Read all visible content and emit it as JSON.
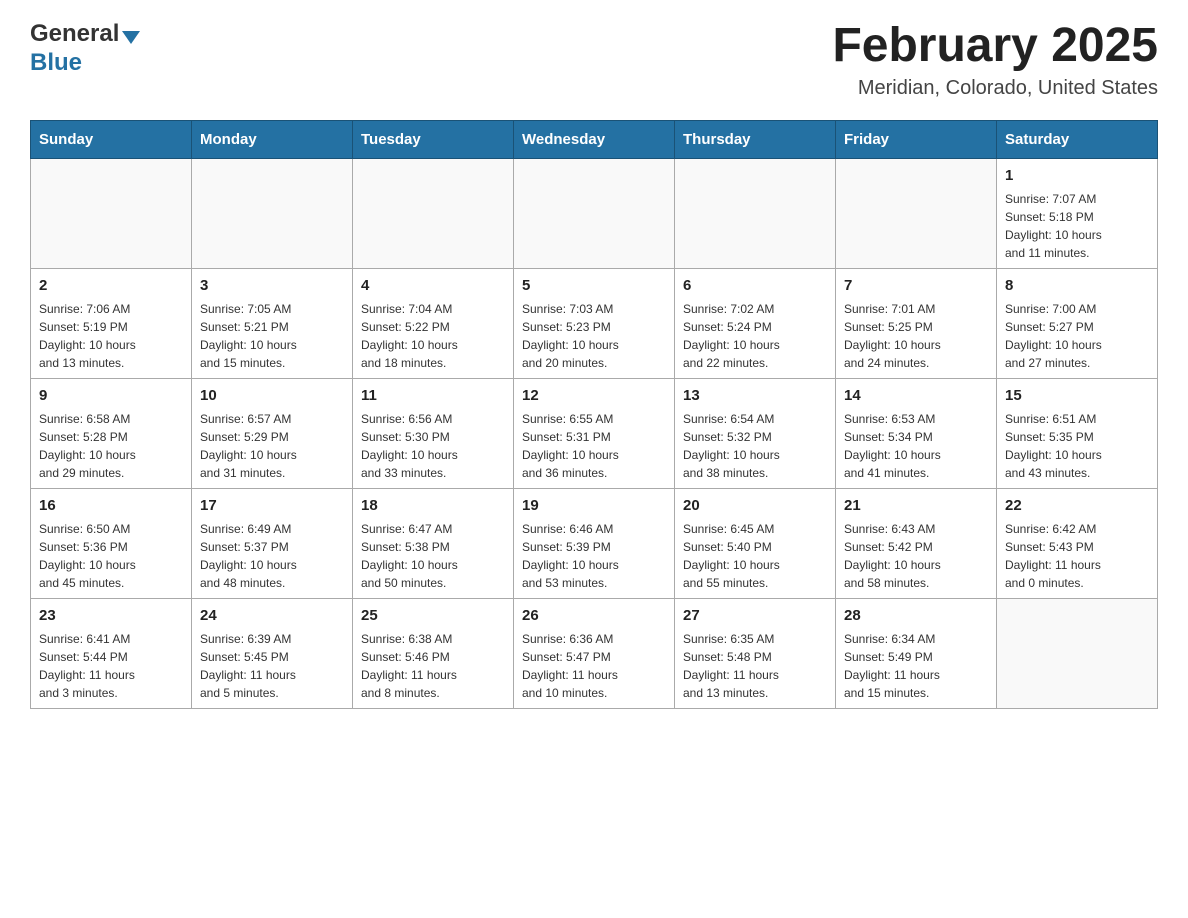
{
  "header": {
    "title": "February 2025",
    "subtitle": "Meridian, Colorado, United States",
    "logo_general": "General",
    "logo_blue": "Blue"
  },
  "days_of_week": [
    "Sunday",
    "Monday",
    "Tuesday",
    "Wednesday",
    "Thursday",
    "Friday",
    "Saturday"
  ],
  "weeks": [
    [
      {
        "day": "",
        "info": "",
        "empty": true
      },
      {
        "day": "",
        "info": "",
        "empty": true
      },
      {
        "day": "",
        "info": "",
        "empty": true
      },
      {
        "day": "",
        "info": "",
        "empty": true
      },
      {
        "day": "",
        "info": "",
        "empty": true
      },
      {
        "day": "",
        "info": "",
        "empty": true
      },
      {
        "day": "1",
        "info": "Sunrise: 7:07 AM\nSunset: 5:18 PM\nDaylight: 10 hours\nand 11 minutes.",
        "empty": false
      }
    ],
    [
      {
        "day": "2",
        "info": "Sunrise: 7:06 AM\nSunset: 5:19 PM\nDaylight: 10 hours\nand 13 minutes.",
        "empty": false
      },
      {
        "day": "3",
        "info": "Sunrise: 7:05 AM\nSunset: 5:21 PM\nDaylight: 10 hours\nand 15 minutes.",
        "empty": false
      },
      {
        "day": "4",
        "info": "Sunrise: 7:04 AM\nSunset: 5:22 PM\nDaylight: 10 hours\nand 18 minutes.",
        "empty": false
      },
      {
        "day": "5",
        "info": "Sunrise: 7:03 AM\nSunset: 5:23 PM\nDaylight: 10 hours\nand 20 minutes.",
        "empty": false
      },
      {
        "day": "6",
        "info": "Sunrise: 7:02 AM\nSunset: 5:24 PM\nDaylight: 10 hours\nand 22 minutes.",
        "empty": false
      },
      {
        "day": "7",
        "info": "Sunrise: 7:01 AM\nSunset: 5:25 PM\nDaylight: 10 hours\nand 24 minutes.",
        "empty": false
      },
      {
        "day": "8",
        "info": "Sunrise: 7:00 AM\nSunset: 5:27 PM\nDaylight: 10 hours\nand 27 minutes.",
        "empty": false
      }
    ],
    [
      {
        "day": "9",
        "info": "Sunrise: 6:58 AM\nSunset: 5:28 PM\nDaylight: 10 hours\nand 29 minutes.",
        "empty": false
      },
      {
        "day": "10",
        "info": "Sunrise: 6:57 AM\nSunset: 5:29 PM\nDaylight: 10 hours\nand 31 minutes.",
        "empty": false
      },
      {
        "day": "11",
        "info": "Sunrise: 6:56 AM\nSunset: 5:30 PM\nDaylight: 10 hours\nand 33 minutes.",
        "empty": false
      },
      {
        "day": "12",
        "info": "Sunrise: 6:55 AM\nSunset: 5:31 PM\nDaylight: 10 hours\nand 36 minutes.",
        "empty": false
      },
      {
        "day": "13",
        "info": "Sunrise: 6:54 AM\nSunset: 5:32 PM\nDaylight: 10 hours\nand 38 minutes.",
        "empty": false
      },
      {
        "day": "14",
        "info": "Sunrise: 6:53 AM\nSunset: 5:34 PM\nDaylight: 10 hours\nand 41 minutes.",
        "empty": false
      },
      {
        "day": "15",
        "info": "Sunrise: 6:51 AM\nSunset: 5:35 PM\nDaylight: 10 hours\nand 43 minutes.",
        "empty": false
      }
    ],
    [
      {
        "day": "16",
        "info": "Sunrise: 6:50 AM\nSunset: 5:36 PM\nDaylight: 10 hours\nand 45 minutes.",
        "empty": false
      },
      {
        "day": "17",
        "info": "Sunrise: 6:49 AM\nSunset: 5:37 PM\nDaylight: 10 hours\nand 48 minutes.",
        "empty": false
      },
      {
        "day": "18",
        "info": "Sunrise: 6:47 AM\nSunset: 5:38 PM\nDaylight: 10 hours\nand 50 minutes.",
        "empty": false
      },
      {
        "day": "19",
        "info": "Sunrise: 6:46 AM\nSunset: 5:39 PM\nDaylight: 10 hours\nand 53 minutes.",
        "empty": false
      },
      {
        "day": "20",
        "info": "Sunrise: 6:45 AM\nSunset: 5:40 PM\nDaylight: 10 hours\nand 55 minutes.",
        "empty": false
      },
      {
        "day": "21",
        "info": "Sunrise: 6:43 AM\nSunset: 5:42 PM\nDaylight: 10 hours\nand 58 minutes.",
        "empty": false
      },
      {
        "day": "22",
        "info": "Sunrise: 6:42 AM\nSunset: 5:43 PM\nDaylight: 11 hours\nand 0 minutes.",
        "empty": false
      }
    ],
    [
      {
        "day": "23",
        "info": "Sunrise: 6:41 AM\nSunset: 5:44 PM\nDaylight: 11 hours\nand 3 minutes.",
        "empty": false
      },
      {
        "day": "24",
        "info": "Sunrise: 6:39 AM\nSunset: 5:45 PM\nDaylight: 11 hours\nand 5 minutes.",
        "empty": false
      },
      {
        "day": "25",
        "info": "Sunrise: 6:38 AM\nSunset: 5:46 PM\nDaylight: 11 hours\nand 8 minutes.",
        "empty": false
      },
      {
        "day": "26",
        "info": "Sunrise: 6:36 AM\nSunset: 5:47 PM\nDaylight: 11 hours\nand 10 minutes.",
        "empty": false
      },
      {
        "day": "27",
        "info": "Sunrise: 6:35 AM\nSunset: 5:48 PM\nDaylight: 11 hours\nand 13 minutes.",
        "empty": false
      },
      {
        "day": "28",
        "info": "Sunrise: 6:34 AM\nSunset: 5:49 PM\nDaylight: 11 hours\nand 15 minutes.",
        "empty": false
      },
      {
        "day": "",
        "info": "",
        "empty": true
      }
    ]
  ]
}
